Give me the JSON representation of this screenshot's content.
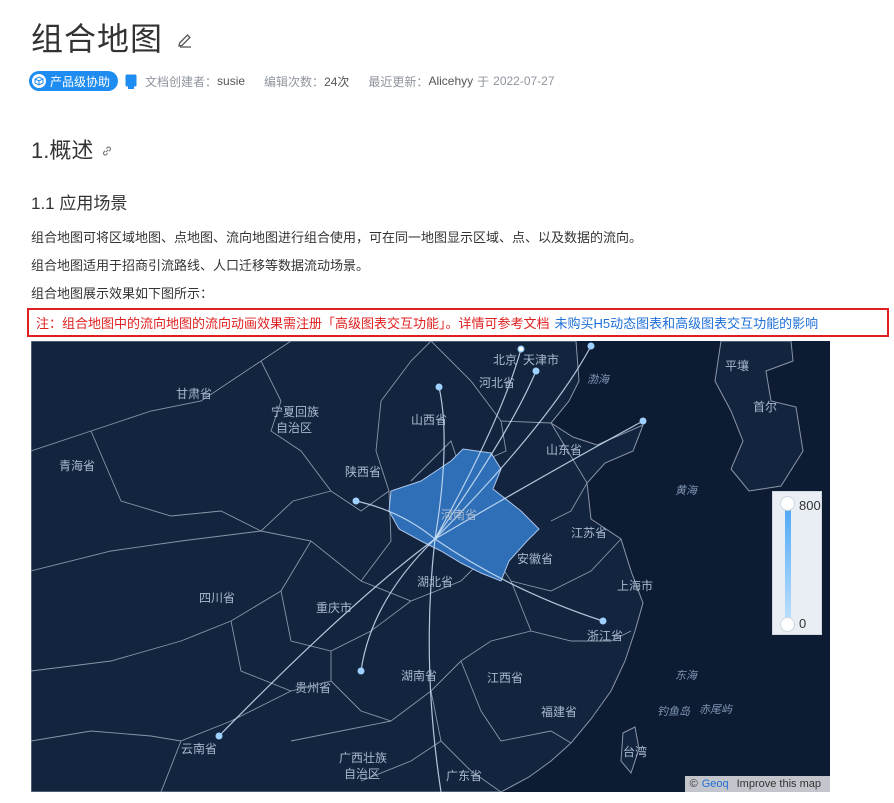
{
  "doc": {
    "title": "组合地图",
    "badge": "产品级协助",
    "creator_label": "文档创建者：",
    "creator": "susie",
    "edits_label": "编辑次数：",
    "edits": "24次",
    "updated_label": "最近更新：",
    "updated_by": "Alicehyy",
    "updated_on_word": "于",
    "updated_date": "2022-07-27"
  },
  "section": {
    "h1": "1.概述",
    "h2": "1.1 应用场景",
    "p1": "组合地图可将区域地图、点地图、流向地图进行组合使用，可在同一地图显示区域、点、以及数据的流向。",
    "p2": "组合地图适用于招商引流路线、人口迁移等数据流动场景。",
    "p3": "组合地图展示效果如下图所示："
  },
  "note": {
    "text": "注：组合地图中的流向地图的流向动画效果需注册「高级图表交互功能」。详情可参考文档",
    "link": "未购买H5动态图表和高级图表交互功能的影响"
  },
  "map": {
    "legend_max": "800",
    "legend_min": "0",
    "legend_min_value": 0,
    "legend_max_value": 800,
    "attribution_prefix": "©",
    "attribution_link": "Geoq",
    "attribution_improve": "Improve this map",
    "colors": {
      "ocean": "#0d1b33",
      "land": "#13243f",
      "border": "#8a96a8",
      "highlight": "#2f6fb8",
      "flow": "#cfe3f7",
      "point": "#9fd0ff"
    },
    "labels": [
      {
        "id": "beijing",
        "text": "北京"
      },
      {
        "id": "tianjin",
        "text": "天津市"
      },
      {
        "id": "hebei",
        "text": "河北省"
      },
      {
        "id": "gansu",
        "text": "甘肃省"
      },
      {
        "id": "ningxia1",
        "text": "宁夏回族"
      },
      {
        "id": "ningxia2",
        "text": "自治区"
      },
      {
        "id": "shanxi",
        "text": "山西省"
      },
      {
        "id": "shandong",
        "text": "山东省"
      },
      {
        "id": "qinghai",
        "text": "青海省"
      },
      {
        "id": "shaanxi",
        "text": "陕西省"
      },
      {
        "id": "henan",
        "text": "河南省"
      },
      {
        "id": "jiangsu",
        "text": "江苏省"
      },
      {
        "id": "anhui",
        "text": "安徽省"
      },
      {
        "id": "sichuan",
        "text": "四川省"
      },
      {
        "id": "hubei",
        "text": "湖北省"
      },
      {
        "id": "chongqing",
        "text": "重庆市"
      },
      {
        "id": "shanghai",
        "text": "上海市"
      },
      {
        "id": "zhejiang",
        "text": "浙江省"
      },
      {
        "id": "guizhou",
        "text": "贵州省"
      },
      {
        "id": "hunan",
        "text": "湖南省"
      },
      {
        "id": "jiangxi",
        "text": "江西省"
      },
      {
        "id": "fujian",
        "text": "福建省"
      },
      {
        "id": "yunnan",
        "text": "云南省"
      },
      {
        "id": "guangxi1",
        "text": "广西壮族"
      },
      {
        "id": "guangxi2",
        "text": "自治区"
      },
      {
        "id": "guangdong",
        "text": "广东省"
      },
      {
        "id": "taiwan",
        "text": "台湾"
      },
      {
        "id": "pyongyang",
        "text": "平壤"
      },
      {
        "id": "seoul",
        "text": "首尔"
      },
      {
        "id": "bohai",
        "text": "渤海"
      },
      {
        "id": "yellowsea",
        "text": "黄海"
      },
      {
        "id": "eastsea",
        "text": "东海"
      },
      {
        "id": "diaoyu",
        "text": "钓鱼岛"
      },
      {
        "id": "chiwei",
        "text": "赤尾屿"
      }
    ]
  }
}
